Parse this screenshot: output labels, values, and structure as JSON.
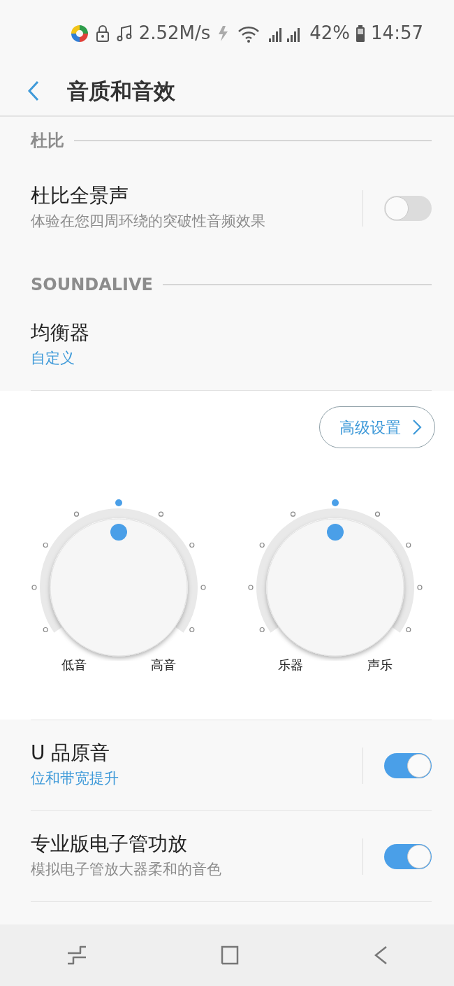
{
  "status_bar": {
    "network_speed": "2.52M/s",
    "battery": "42%",
    "time": "14:57"
  },
  "header": {
    "title": "音质和音效"
  },
  "sections": [
    {
      "title": "杜比",
      "items": [
        {
          "kind": "toggle",
          "title": "杜比全景声",
          "subtitle": "体验在您四周环绕的突破性音频效果",
          "subtitle_highlighted": false,
          "on": false
        }
      ]
    },
    {
      "title": "SOUNDALIVE",
      "items": [
        {
          "kind": "link",
          "title": "均衡器",
          "subtitle": "自定义",
          "subtitle_highlighted": true
        }
      ]
    }
  ],
  "equalizer": {
    "button": "高级设置",
    "dials": [
      {
        "left_label": "低音",
        "right_label": "高音",
        "level": 0.5
      },
      {
        "left_label": "乐器",
        "right_label": "声乐",
        "level": 0.5
      }
    ]
  },
  "options": [
    {
      "kind": "toggle",
      "title": "U 品原音",
      "subtitle": "位和带宽提升",
      "subtitle_highlighted": true,
      "on": true
    },
    {
      "kind": "toggle",
      "title": "专业版电子管功放",
      "subtitle": "模拟电子管放大器柔和的音色",
      "subtitle_highlighted": false,
      "on": true
    }
  ]
}
